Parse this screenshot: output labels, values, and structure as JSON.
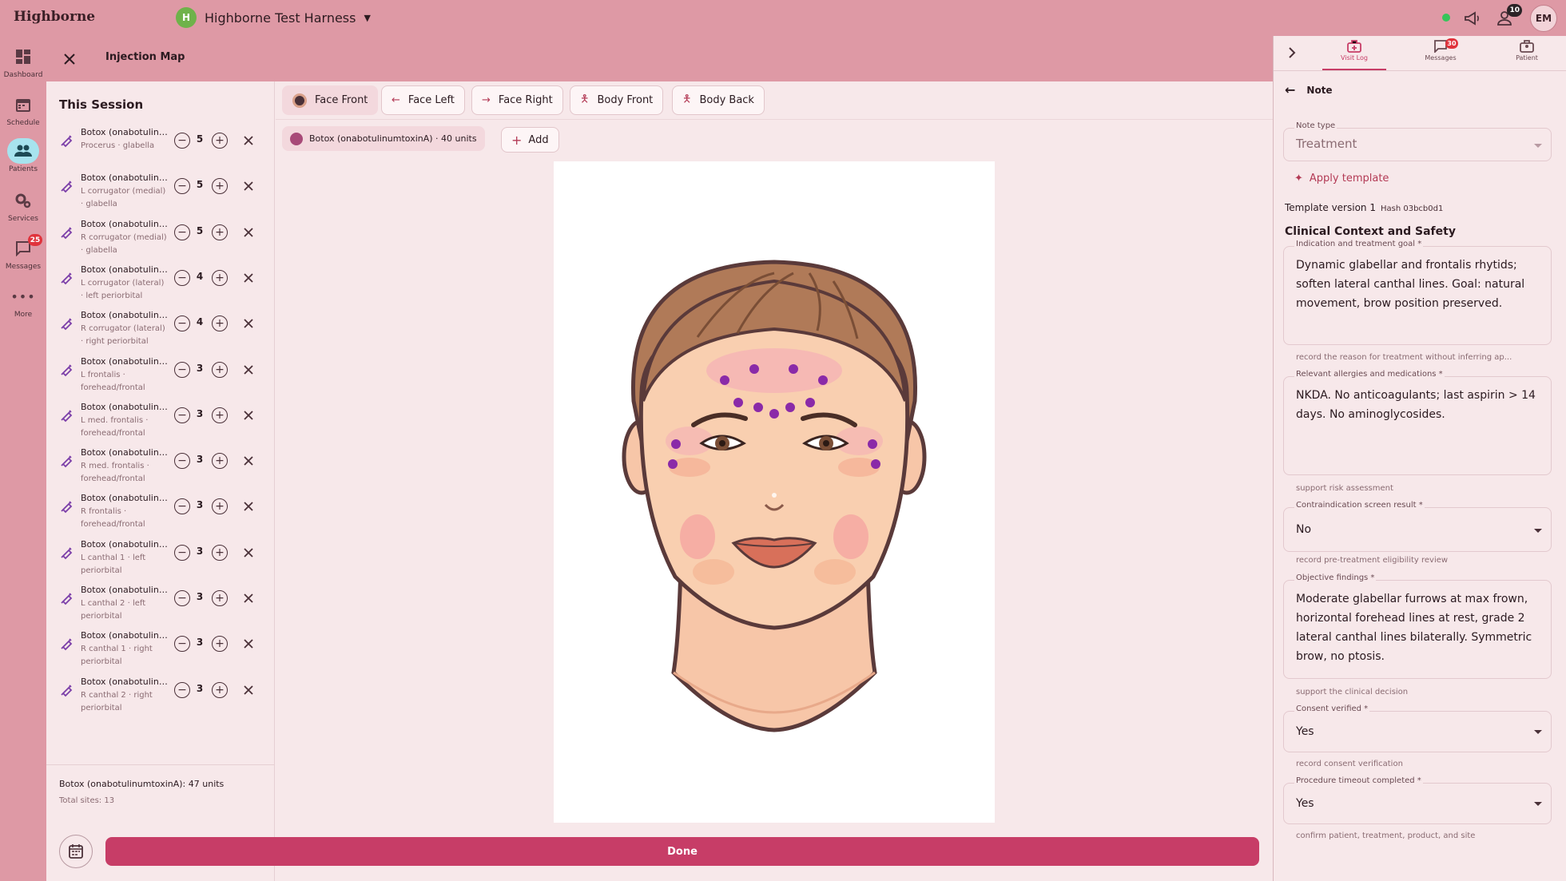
{
  "app": {
    "brand": "Highborne"
  },
  "workspace": {
    "initial": "H",
    "name": "Highborne Test Harness"
  },
  "topbar": {
    "team_badge": "10",
    "avatar": "EM"
  },
  "nav": [
    {
      "label": "Dashboard",
      "icon": "dashboard-icon"
    },
    {
      "label": "Schedule",
      "icon": "calendar-icon"
    },
    {
      "label": "Patients",
      "icon": "people-icon",
      "active": true
    },
    {
      "label": "Services",
      "icon": "gear-icon"
    },
    {
      "label": "Messages",
      "icon": "chat-icon",
      "badge": "25"
    },
    {
      "label": "More",
      "icon": "more-icon"
    }
  ],
  "modal": {
    "title": "Injection Map"
  },
  "session": {
    "title": "This Session",
    "items": [
      {
        "name": "Botox (onabotulinumtoxinA)",
        "site": "Procerus · glabella",
        "qty": "5"
      },
      {
        "name": "Botox (onabotulinumtoxinA)",
        "site": "L corrugator (medial) · glabella",
        "qty": "5"
      },
      {
        "name": "Botox (onabotulinumtoxinA)",
        "site": "R corrugator (medial) · glabella",
        "qty": "5"
      },
      {
        "name": "Botox (onabotulinumtoxinA)",
        "site": "L corrugator (lateral) · left periorbital",
        "qty": "4"
      },
      {
        "name": "Botox (onabotulinumtoxinA)",
        "site": "R corrugator (lateral) · right periorbital",
        "qty": "4"
      },
      {
        "name": "Botox (onabotulinumtoxinA)",
        "site": "L frontalis · forehead/frontal",
        "qty": "3"
      },
      {
        "name": "Botox (onabotulinumtoxinA)",
        "site": "L med. frontalis · forehead/frontal",
        "qty": "3"
      },
      {
        "name": "Botox (onabotulinumtoxinA)",
        "site": "R med. frontalis · forehead/frontal",
        "qty": "3"
      },
      {
        "name": "Botox (onabotulinumtoxinA)",
        "site": "R frontalis · forehead/frontal",
        "qty": "3"
      },
      {
        "name": "Botox (onabotulinumtoxinA)",
        "site": "L canthal 1 · left periorbital",
        "qty": "3"
      },
      {
        "name": "Botox (onabotulinumtoxinA)",
        "site": "L canthal 2 · left periorbital",
        "qty": "3"
      },
      {
        "name": "Botox (onabotulinumtoxinA)",
        "site": "R canthal 1 · right periorbital",
        "qty": "3"
      },
      {
        "name": "Botox (onabotulinumtoxinA)",
        "site": "R canthal 2 · right periorbital",
        "qty": "3"
      }
    ],
    "summary": "Botox (onabotulinumtoxinA): 47 units",
    "total_sites": "Total sites: 13"
  },
  "views": [
    "Face Front",
    "Face Left",
    "Face Right",
    "Body Front",
    "Body Back"
  ],
  "product_chip": "Botox (onabotulinumtoxinA) · 40 units",
  "add_label": "Add",
  "done_label": "Done",
  "right": {
    "tabs": [
      {
        "label": "Visit Log",
        "active": true
      },
      {
        "label": "Messages",
        "badge": "30"
      },
      {
        "label": "Patient"
      }
    ],
    "note_title": "Note",
    "note_type_label": "Note type",
    "note_type_value": "Treatment",
    "apply_template": "Apply template",
    "template_version": "Template version 1",
    "hash": "Hash 03bcb0d1",
    "section": "Clinical Context and Safety",
    "fields": [
      {
        "label": "Indication and treatment goal *",
        "value": "Dynamic glabellar and frontalis rhytids; soften lateral canthal lines. Goal: natural movement, brow position preserved.",
        "help": "record the reason for treatment without inferring ap..."
      },
      {
        "label": "Relevant allergies and medications *",
        "value": "NKDA. No anticoagulants; last aspirin > 14 days. No aminoglycosides.",
        "help": "support risk assessment"
      },
      {
        "label": "Contraindication screen result *",
        "value": "No",
        "help": "record pre-treatment eligibility review"
      },
      {
        "label": "Objective findings *",
        "value": "Moderate glabellar furrows at max frown, horizontal forehead lines at rest, grade 2 lateral canthal lines bilaterally. Symmetric brow, no ptosis.",
        "help": "support the clinical decision"
      },
      {
        "label": "Consent verified *",
        "value": "Yes",
        "help": "record consent verification"
      },
      {
        "label": "Procedure timeout completed *",
        "value": "Yes",
        "help": "confirm patient, treatment, product, and site"
      }
    ]
  },
  "colors": {
    "accent": "#c73d67",
    "topbar": "#de99a5",
    "panel": "#f7e8ea",
    "dot": "#8a2aa8"
  }
}
